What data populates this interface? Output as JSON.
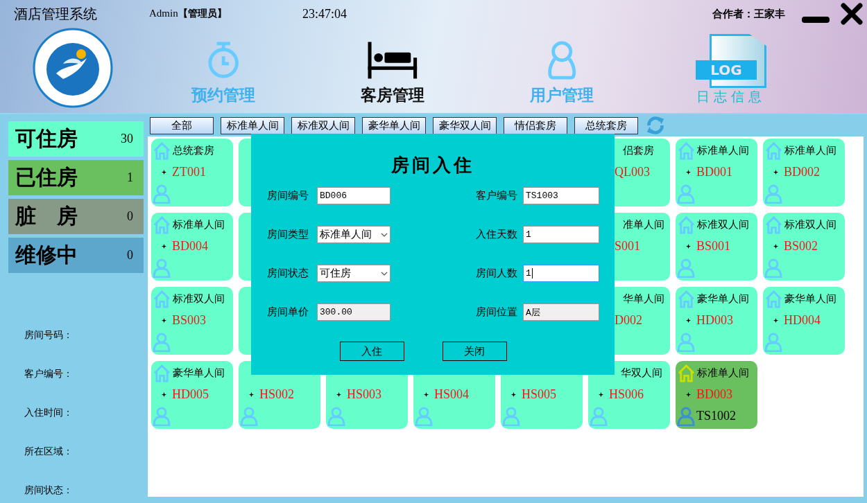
{
  "header": {
    "title": "酒店管理系统",
    "user": "Admin",
    "role": "【管理员】",
    "time": "23:47:04",
    "author": "合作者：王家丰"
  },
  "nav": [
    {
      "label": "预约管理",
      "kind": "clock",
      "selected": false
    },
    {
      "label": "客房管理",
      "kind": "bed",
      "selected": true
    },
    {
      "label": "用户管理",
      "kind": "user",
      "selected": false
    },
    {
      "label": "日志信息",
      "kind": "log",
      "icon_text": "LOG",
      "selected": false
    }
  ],
  "stats": [
    {
      "label": "可住房",
      "count": "30",
      "color": "#66ffcc"
    },
    {
      "label": "已住房",
      "count": "1",
      "color": "#6abf5e"
    },
    {
      "label": "脏　房",
      "count": "0",
      "color": "#879a87"
    },
    {
      "label": "维修中",
      "count": "0",
      "color": "#5ea7cc"
    }
  ],
  "details": [
    "房间号码：",
    "客户编号：",
    "入住时间：",
    "所在区域：",
    "房间状态："
  ],
  "filters": [
    "全部",
    "标准单人间",
    "标准双人间",
    "豪华单人间",
    "豪华双人间",
    "情侣套房",
    "总统套房"
  ],
  "rooms": [
    [
      {
        "kind": "normal",
        "title": "总统套房",
        "id": "ZT001",
        "occupied": false
      },
      {
        "kind": "covered-left",
        "occupied": false
      },
      {
        "kind": "covered-right",
        "title": "侣套房",
        "id": "QL003",
        "occupied": false
      },
      {
        "kind": "normal",
        "title": "标准单人间",
        "id": "BD001",
        "occupied": false
      },
      {
        "kind": "normal",
        "title": "标准单人间",
        "id": "BD002",
        "occupied": false
      }
    ],
    [
      {
        "kind": "normal",
        "title": "标准单人间",
        "id": "BD004",
        "occupied": false
      },
      {
        "kind": "covered-left",
        "occupied": false
      },
      {
        "kind": "covered-right",
        "title": "准单人间",
        "id": "S001",
        "occupied": false
      },
      {
        "kind": "normal",
        "title": "标准双人间",
        "id": "BS001",
        "occupied": false
      },
      {
        "kind": "normal",
        "title": "标准双人间",
        "id": "BS002",
        "occupied": false
      }
    ],
    [
      {
        "kind": "normal",
        "title": "标准双人间",
        "id": "BS003",
        "occupied": false
      },
      {
        "kind": "covered-left",
        "occupied": false
      },
      {
        "kind": "covered-right",
        "title": "华单人间",
        "id": "D002",
        "occupied": false
      },
      {
        "kind": "normal",
        "title": "豪华单人间",
        "id": "HD003",
        "occupied": false
      },
      {
        "kind": "normal",
        "title": "豪华单人间",
        "id": "HD004",
        "occupied": false
      }
    ],
    [
      {
        "kind": "normal",
        "title": "豪华单人间",
        "id": "HD005",
        "occupied": false
      },
      {
        "kind": "covered-top",
        "id": "HS002",
        "occupied": false
      },
      {
        "kind": "covered-top",
        "id": "HS003",
        "occupied": false
      },
      {
        "kind": "covered-top",
        "id": "HS004",
        "occupied": false
      },
      {
        "kind": "covered-top",
        "id": "HS005",
        "occupied": false
      },
      {
        "kind": "covered-top",
        "title": "华双人间",
        "id": "HS006",
        "occupied": false
      },
      {
        "kind": "normal",
        "title": "标准单人间",
        "id": "BD003",
        "guest": "TS1002",
        "occupied": true
      }
    ]
  ],
  "dialog": {
    "title": "房间入住",
    "fields": [
      {
        "label": "房间编号",
        "kind": "text",
        "value": "BD006",
        "focused": false
      },
      {
        "label": "客户编号",
        "kind": "text",
        "value": "TS1003",
        "focused": false
      },
      {
        "label": "房间类型",
        "kind": "select",
        "value": "标准单人间",
        "focused": false
      },
      {
        "label": "入住天数",
        "kind": "text",
        "value": "1",
        "focused": false
      },
      {
        "label": "房间状态",
        "kind": "select",
        "value": "可住房",
        "focused": false
      },
      {
        "label": "房间人数",
        "kind": "text",
        "value": "1",
        "focused": true
      },
      {
        "label": "房间单价",
        "kind": "readonly",
        "value": "300.00",
        "focused": false
      },
      {
        "label": "房间位置",
        "kind": "readonly",
        "value": "A层",
        "focused": false
      }
    ],
    "buttons": [
      "入住",
      "关闭"
    ]
  }
}
